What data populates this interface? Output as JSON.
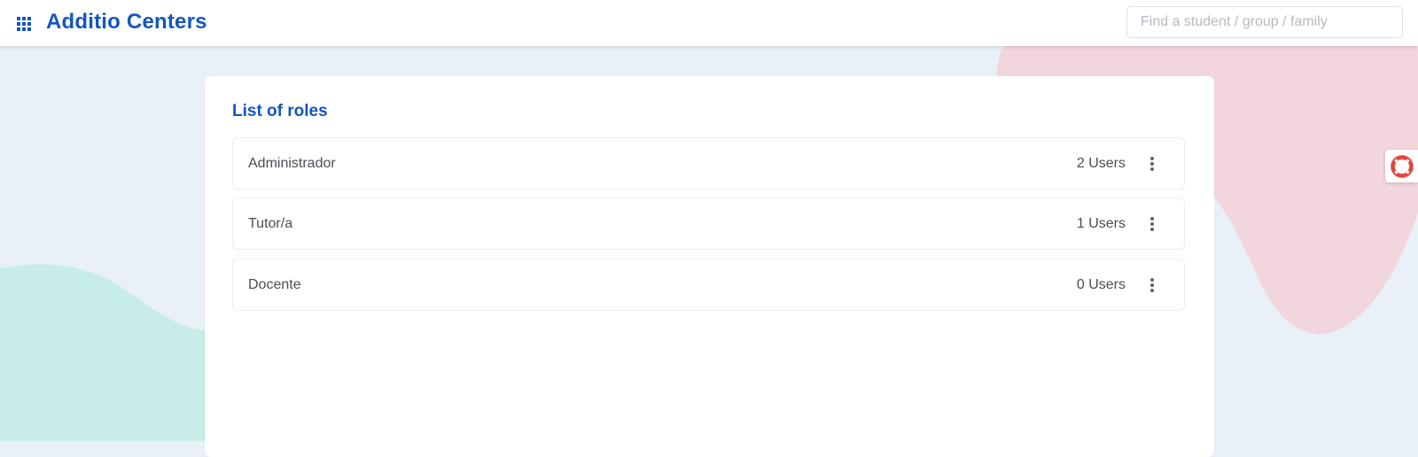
{
  "header": {
    "brand": "Additio Centers",
    "apps_icon": "grid-apps-icon",
    "search": {
      "placeholder": "Find a student / group / family",
      "value": ""
    }
  },
  "roles_panel": {
    "title": "List of roles",
    "roles": [
      {
        "name": "Administrador",
        "count": "2 Users",
        "menu_icon": "more-vertical-icon"
      },
      {
        "name": "Tutor/a",
        "count": "1 Users",
        "menu_icon": "more-vertical-icon"
      },
      {
        "name": "Docente",
        "count": "0 Users",
        "menu_icon": "more-vertical-icon"
      }
    ]
  },
  "help": {
    "icon": "lifebuoy-icon"
  },
  "colors": {
    "brand_blue": "#1455c0",
    "background": "#e9f0f7",
    "blob_pink": "#f2d6dd",
    "blob_teal": "#c8ece8",
    "lifebuoy_red": "#e8443a"
  }
}
